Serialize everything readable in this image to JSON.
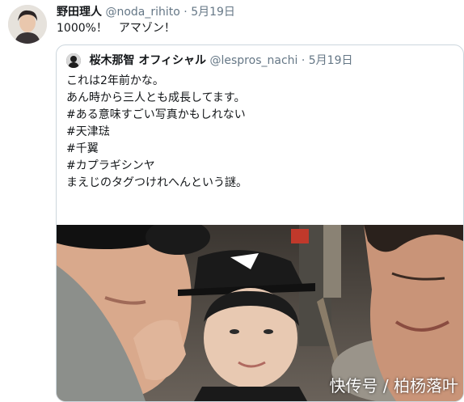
{
  "tweet": {
    "display_name": "野田理人",
    "handle": "@noda_rihito",
    "separator": "·",
    "date": "5月19日",
    "text": "1000%！　アマゾン！"
  },
  "quoted_tweet": {
    "display_name": "桜木那智 オフィシャル",
    "handle": "@lespros_nachi",
    "separator": "·",
    "date": "5月19日",
    "lines": [
      "これは2年前かな。",
      "あん時から三人とも成長してます。",
      "",
      "#ある意味すごい写真かもしれない",
      "#天津琺",
      "#千翼",
      "#カプラギシンヤ",
      "",
      "まえじのタグつけれへんという謎。"
    ]
  },
  "watermark": "快传号 / 柏杨落叶",
  "colors": {
    "text": "#14171a",
    "muted": "#657786",
    "border": "#ccd6dd"
  }
}
